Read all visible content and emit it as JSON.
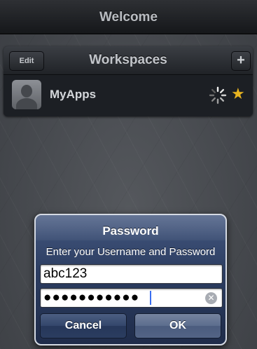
{
  "titlebar": {
    "title": "Welcome"
  },
  "workspaces": {
    "title": "Workspaces",
    "edit_label": "Edit",
    "add_label": "+",
    "items": [
      {
        "name": "MyApps",
        "icon": "user-silhouette-icon",
        "loading": true,
        "favorite": true
      }
    ]
  },
  "dialog": {
    "title": "Password",
    "message": "Enter your Username and Password",
    "username_value": "abc123",
    "password_value": "●●●●●●●●●●●",
    "cancel_label": "Cancel",
    "ok_label": "OK"
  },
  "colors": {
    "star": "#e8b420",
    "dialog_bg": "#2c3d61",
    "cursor": "#3a6ef0"
  }
}
